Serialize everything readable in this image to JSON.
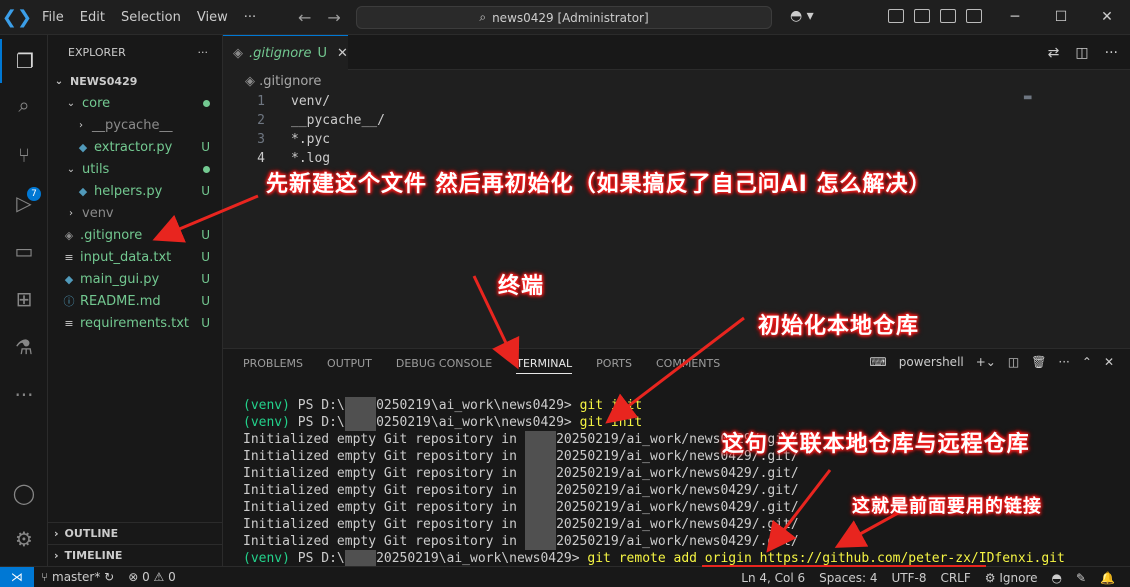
{
  "titlebar": {
    "menu": [
      "File",
      "Edit",
      "Selection",
      "View",
      "···"
    ],
    "search_text": "news0429 [Administrator]",
    "window_controls": [
      "minimize-icon",
      "maximize-icon",
      "close-icon"
    ]
  },
  "activity": {
    "items": [
      "explorer-icon",
      "search-icon",
      "source-control-icon",
      "run-debug-icon",
      "remote-explorer-icon",
      "extensions-icon",
      "testing-icon",
      "more-icon"
    ],
    "scm_badge": "7"
  },
  "explorer": {
    "title": "EXPLORER",
    "more": "···",
    "root": "NEWS0429",
    "items": [
      {
        "label": "core",
        "kind": "folder-open",
        "status": "dot"
      },
      {
        "label": "__pycache__",
        "kind": "folder",
        "status": ""
      },
      {
        "label": "extractor.py",
        "kind": "py",
        "status": "U"
      },
      {
        "label": "utils",
        "kind": "folder-open",
        "status": "dot"
      },
      {
        "label": "helpers.py",
        "kind": "py",
        "status": "U"
      },
      {
        "label": "venv",
        "kind": "folder",
        "status": ""
      },
      {
        "label": ".gitignore",
        "kind": "git",
        "status": "U"
      },
      {
        "label": "input_data.txt",
        "kind": "txt",
        "status": "U"
      },
      {
        "label": "main_gui.py",
        "kind": "py",
        "status": "U"
      },
      {
        "label": "README.md",
        "kind": "info",
        "status": "U"
      },
      {
        "label": "requirements.txt",
        "kind": "txt",
        "status": "U"
      }
    ],
    "outline": "OUTLINE",
    "timeline": "TIMELINE"
  },
  "editor": {
    "tab_label": ".gitignore",
    "tab_status": "U",
    "breadcrumb": ".gitignore",
    "lines": [
      {
        "n": "1",
        "text": "venv/"
      },
      {
        "n": "2",
        "text": "__pycache__/"
      },
      {
        "n": "3",
        "text": "*.pyc"
      },
      {
        "n": "4",
        "text": "*.log"
      }
    ]
  },
  "panel": {
    "tabs": [
      "PROBLEMS",
      "OUTPUT",
      "DEBUG CONSOLE",
      "TERMINAL",
      "PORTS",
      "COMMENTS"
    ],
    "active_tab": "TERMINAL",
    "shell": "powershell",
    "terminal": [
      {
        "venv": "(venv)",
        "pre": " PS D:\\",
        "redact": "xxxx",
        "post": "0250219\\ai_work\\news0429> ",
        "cmd": "git init"
      },
      {
        "venv": "(venv)",
        "pre": " PS D:\\",
        "redact": "xxxx",
        "post": "0250219\\ai_work\\news0429> ",
        "cmd": "git init"
      },
      {
        "venv": "",
        "pre": "Initialized empty Git repository in ",
        "redact": "xxxx",
        "post": "20250219/ai_work/news0429/.git/",
        "cmd": ""
      },
      {
        "venv": "",
        "pre": "Initialized empty Git repository in ",
        "redact": "xxxx",
        "post": "20250219/ai_work/news0429/.git/",
        "cmd": ""
      },
      {
        "venv": "",
        "pre": "Initialized empty Git repository in ",
        "redact": "xxxx",
        "post": "20250219/ai_work/news0429/.git/",
        "cmd": ""
      },
      {
        "venv": "",
        "pre": "Initialized empty Git repository in ",
        "redact": "xxxx",
        "post": "20250219/ai_work/news0429/.git/",
        "cmd": ""
      },
      {
        "venv": "",
        "pre": "Initialized empty Git repository in ",
        "redact": "xxxx",
        "post": "20250219/ai_work/news0429/.git/",
        "cmd": ""
      },
      {
        "venv": "",
        "pre": "Initialized empty Git repository in ",
        "redact": "xxxx",
        "post": "20250219/ai_work/news0429/.git/",
        "cmd": ""
      },
      {
        "venv": "",
        "pre": "Initialized empty Git repository in ",
        "redact": "xxxx",
        "post": "20250219/ai_work/news0429/.git/",
        "cmd": ""
      },
      {
        "venv": "(venv)",
        "pre": " PS D:\\",
        "redact": "xxxx",
        "post": "20250219\\ai_work\\news0429> ",
        "cmd": "git remote add origin https://github.com/peter-zx/IDfenxi.git"
      }
    ]
  },
  "status": {
    "branch": "master*",
    "problems": "⊗ 0 ⚠ 0",
    "position": "Ln 4, Col 6",
    "spaces": "Spaces: 4",
    "encoding": "UTF-8",
    "eol": "CRLF",
    "ignore": "Ignore"
  },
  "annotations": {
    "a1": "先新建这个文件  然后再初始化（如果搞反了自己问AI 怎么解决）",
    "a2": "终端",
    "a3": "初始化本地仓库",
    "a4": "这句 关联本地仓库与远程仓库",
    "a5": "这就是前面要用的链接"
  },
  "colors": {
    "accent": "#0078d4",
    "untracked": "#73c991",
    "annotation_outline": "#ff2020",
    "arrow": "#e8251f"
  }
}
